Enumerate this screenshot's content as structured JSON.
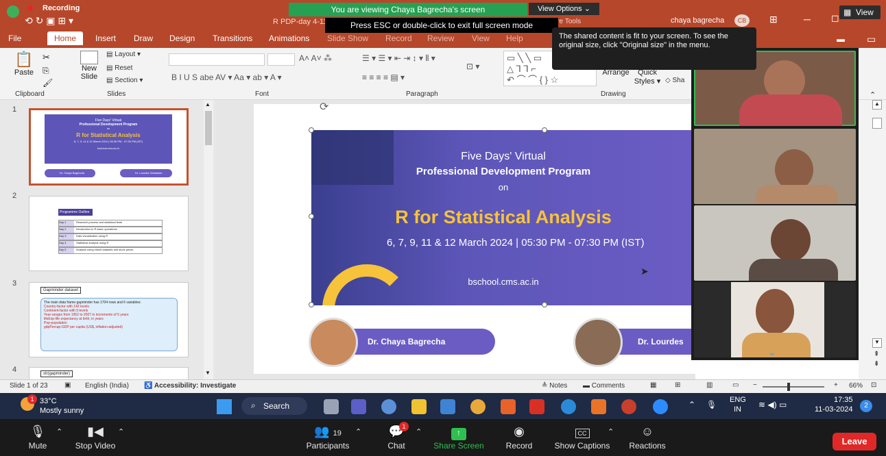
{
  "titlebar": {
    "recording": "Recording",
    "doc_title": "R PDP-day 4-11-3-2024.pptx",
    "user": "chaya bagrecha",
    "initials": "CB",
    "picture_tools": "Picture Tools"
  },
  "share": {
    "viewing": "You are viewing Chaya Bagrecha's screen",
    "view_options": "View Options",
    "esc_hint": "Press ESC or double-click to exit full screen mode",
    "tooltip": "The shared content is fit to your screen. To see the original size, click \"Original size\" in the menu.",
    "view_btn": "View"
  },
  "ribbon": {
    "tabs": [
      "File",
      "Home",
      "Insert",
      "Draw",
      "Design",
      "Transitions",
      "Animations",
      "Slide Show",
      "Record",
      "Review",
      "View",
      "Help"
    ],
    "paste": "Paste",
    "new_slide": "New",
    "new_slide2": "Slide",
    "layout": "Layout",
    "reset": "Reset",
    "section": "Section",
    "arrange": "Arrange",
    "quick": "Quick",
    "styles": "Styles",
    "shape": "Sha",
    "groups": {
      "clipboard": "Clipboard",
      "slides": "Slides",
      "font": "Font",
      "paragraph": "Paragraph",
      "drawing": "Drawing"
    }
  },
  "thumbnails": [
    {
      "num": "1",
      "title": "R for Statistical Analysis",
      "sub": "Five Days' Virtual",
      "sub2": "Professional Development Program",
      "on": "on",
      "dates": "6, 7, 9, 11 & 12 March 2024 | 05:30 PM - 07:30 PM (IST)",
      "site": "bschool.cms.ac.in",
      "p1": "Dr. Chaya Bagrecha",
      "p2": "Dr. Lourdes Sebastian"
    },
    {
      "num": "2",
      "title": "Programme Outline",
      "rows": [
        {
          "day": "Day 1",
          "topic": "Research process and statistical tests"
        },
        {
          "day": "Day 2",
          "topic": "Introduction to R-basic operations"
        },
        {
          "day": "Day 3",
          "topic": "Data visualization using R"
        },
        {
          "day": "Day 4",
          "topic": "Statistical analysis using R"
        },
        {
          "day": "Day 5",
          "topic": "Analysis using inbuilt datasets and stock prices"
        }
      ]
    },
    {
      "num": "3",
      "title": "Gapminder dataset",
      "intro": "The main data frame gapminder has 1704 rows and 6 variables:",
      "items": [
        "Country-factor with 142 levels",
        "Continent-factor with 5 levels",
        "Year-ranges from 1952 to 2007 in increments of 5 years",
        "lifeExp-life expectancy at birth, in years",
        "Pop-population",
        "gdpPercap-GDP per capita (US$, inflation-adjusted)"
      ]
    },
    {
      "num": "4",
      "title": "str(gapminder)"
    }
  ],
  "slide": {
    "line1": "Five Days' Virtual",
    "line2": "Professional Development Program",
    "line3": "on",
    "title": "R for Statistical Analysis",
    "dates": "6, 7, 9, 11 & 12 March 2024 | 05:30 PM - 07:30 PM (IST)",
    "site": "bschool.cms.ac.in",
    "presenter1": "Dr. Chaya Bagrecha",
    "presenter2": "Dr. Lourdes"
  },
  "statusbar": {
    "slide": "Slide 1 of 23",
    "lang": "English (India)",
    "access": "Accessibility: Investigate",
    "notes": "Notes",
    "comments": "Comments",
    "zoom": "66%"
  },
  "taskbar": {
    "temp": "33°C",
    "weather": "Mostly sunny",
    "search": "Search",
    "lang1": "ENG",
    "lang2": "IN",
    "time": "17:35",
    "date": "11-03-2024",
    "badge": "1",
    "notif": "2"
  },
  "zoom": {
    "mute": "Mute",
    "video": "Stop Video",
    "participants": "Participants",
    "participants_count": "19",
    "chat": "Chat",
    "chat_badge": "1",
    "share": "Share Screen",
    "record": "Record",
    "captions": "Show Captions",
    "reactions": "Reactions",
    "leave": "Leave"
  },
  "colors": {
    "ppt_red": "#b7472a",
    "zoom_green": "#26a153",
    "leave": "#e02828",
    "banner": "#5d56b8",
    "accent_yellow": "#f6c33a"
  }
}
